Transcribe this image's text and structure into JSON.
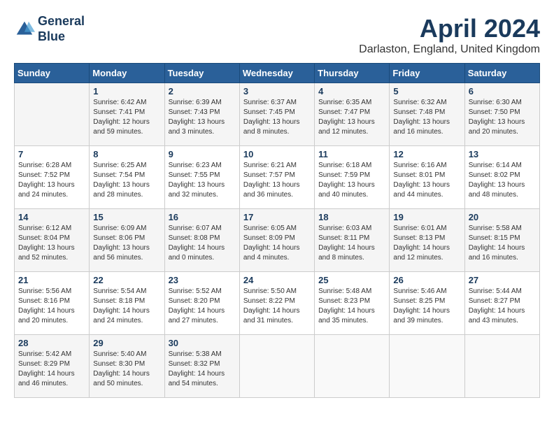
{
  "logo": {
    "line1": "General",
    "line2": "Blue"
  },
  "title": "April 2024",
  "location": "Darlaston, England, United Kingdom",
  "days_of_week": [
    "Sunday",
    "Monday",
    "Tuesday",
    "Wednesday",
    "Thursday",
    "Friday",
    "Saturday"
  ],
  "weeks": [
    [
      {
        "day": "",
        "sunrise": "",
        "sunset": "",
        "daylight": ""
      },
      {
        "day": "1",
        "sunrise": "Sunrise: 6:42 AM",
        "sunset": "Sunset: 7:41 PM",
        "daylight": "Daylight: 12 hours and 59 minutes."
      },
      {
        "day": "2",
        "sunrise": "Sunrise: 6:39 AM",
        "sunset": "Sunset: 7:43 PM",
        "daylight": "Daylight: 13 hours and 3 minutes."
      },
      {
        "day": "3",
        "sunrise": "Sunrise: 6:37 AM",
        "sunset": "Sunset: 7:45 PM",
        "daylight": "Daylight: 13 hours and 8 minutes."
      },
      {
        "day": "4",
        "sunrise": "Sunrise: 6:35 AM",
        "sunset": "Sunset: 7:47 PM",
        "daylight": "Daylight: 13 hours and 12 minutes."
      },
      {
        "day": "5",
        "sunrise": "Sunrise: 6:32 AM",
        "sunset": "Sunset: 7:48 PM",
        "daylight": "Daylight: 13 hours and 16 minutes."
      },
      {
        "day": "6",
        "sunrise": "Sunrise: 6:30 AM",
        "sunset": "Sunset: 7:50 PM",
        "daylight": "Daylight: 13 hours and 20 minutes."
      }
    ],
    [
      {
        "day": "7",
        "sunrise": "Sunrise: 6:28 AM",
        "sunset": "Sunset: 7:52 PM",
        "daylight": "Daylight: 13 hours and 24 minutes."
      },
      {
        "day": "8",
        "sunrise": "Sunrise: 6:25 AM",
        "sunset": "Sunset: 7:54 PM",
        "daylight": "Daylight: 13 hours and 28 minutes."
      },
      {
        "day": "9",
        "sunrise": "Sunrise: 6:23 AM",
        "sunset": "Sunset: 7:55 PM",
        "daylight": "Daylight: 13 hours and 32 minutes."
      },
      {
        "day": "10",
        "sunrise": "Sunrise: 6:21 AM",
        "sunset": "Sunset: 7:57 PM",
        "daylight": "Daylight: 13 hours and 36 minutes."
      },
      {
        "day": "11",
        "sunrise": "Sunrise: 6:18 AM",
        "sunset": "Sunset: 7:59 PM",
        "daylight": "Daylight: 13 hours and 40 minutes."
      },
      {
        "day": "12",
        "sunrise": "Sunrise: 6:16 AM",
        "sunset": "Sunset: 8:01 PM",
        "daylight": "Daylight: 13 hours and 44 minutes."
      },
      {
        "day": "13",
        "sunrise": "Sunrise: 6:14 AM",
        "sunset": "Sunset: 8:02 PM",
        "daylight": "Daylight: 13 hours and 48 minutes."
      }
    ],
    [
      {
        "day": "14",
        "sunrise": "Sunrise: 6:12 AM",
        "sunset": "Sunset: 8:04 PM",
        "daylight": "Daylight: 13 hours and 52 minutes."
      },
      {
        "day": "15",
        "sunrise": "Sunrise: 6:09 AM",
        "sunset": "Sunset: 8:06 PM",
        "daylight": "Daylight: 13 hours and 56 minutes."
      },
      {
        "day": "16",
        "sunrise": "Sunrise: 6:07 AM",
        "sunset": "Sunset: 8:08 PM",
        "daylight": "Daylight: 14 hours and 0 minutes."
      },
      {
        "day": "17",
        "sunrise": "Sunrise: 6:05 AM",
        "sunset": "Sunset: 8:09 PM",
        "daylight": "Daylight: 14 hours and 4 minutes."
      },
      {
        "day": "18",
        "sunrise": "Sunrise: 6:03 AM",
        "sunset": "Sunset: 8:11 PM",
        "daylight": "Daylight: 14 hours and 8 minutes."
      },
      {
        "day": "19",
        "sunrise": "Sunrise: 6:01 AM",
        "sunset": "Sunset: 8:13 PM",
        "daylight": "Daylight: 14 hours and 12 minutes."
      },
      {
        "day": "20",
        "sunrise": "Sunrise: 5:58 AM",
        "sunset": "Sunset: 8:15 PM",
        "daylight": "Daylight: 14 hours and 16 minutes."
      }
    ],
    [
      {
        "day": "21",
        "sunrise": "Sunrise: 5:56 AM",
        "sunset": "Sunset: 8:16 PM",
        "daylight": "Daylight: 14 hours and 20 minutes."
      },
      {
        "day": "22",
        "sunrise": "Sunrise: 5:54 AM",
        "sunset": "Sunset: 8:18 PM",
        "daylight": "Daylight: 14 hours and 24 minutes."
      },
      {
        "day": "23",
        "sunrise": "Sunrise: 5:52 AM",
        "sunset": "Sunset: 8:20 PM",
        "daylight": "Daylight: 14 hours and 27 minutes."
      },
      {
        "day": "24",
        "sunrise": "Sunrise: 5:50 AM",
        "sunset": "Sunset: 8:22 PM",
        "daylight": "Daylight: 14 hours and 31 minutes."
      },
      {
        "day": "25",
        "sunrise": "Sunrise: 5:48 AM",
        "sunset": "Sunset: 8:23 PM",
        "daylight": "Daylight: 14 hours and 35 minutes."
      },
      {
        "day": "26",
        "sunrise": "Sunrise: 5:46 AM",
        "sunset": "Sunset: 8:25 PM",
        "daylight": "Daylight: 14 hours and 39 minutes."
      },
      {
        "day": "27",
        "sunrise": "Sunrise: 5:44 AM",
        "sunset": "Sunset: 8:27 PM",
        "daylight": "Daylight: 14 hours and 43 minutes."
      }
    ],
    [
      {
        "day": "28",
        "sunrise": "Sunrise: 5:42 AM",
        "sunset": "Sunset: 8:29 PM",
        "daylight": "Daylight: 14 hours and 46 minutes."
      },
      {
        "day": "29",
        "sunrise": "Sunrise: 5:40 AM",
        "sunset": "Sunset: 8:30 PM",
        "daylight": "Daylight: 14 hours and 50 minutes."
      },
      {
        "day": "30",
        "sunrise": "Sunrise: 5:38 AM",
        "sunset": "Sunset: 8:32 PM",
        "daylight": "Daylight: 14 hours and 54 minutes."
      },
      {
        "day": "",
        "sunrise": "",
        "sunset": "",
        "daylight": ""
      },
      {
        "day": "",
        "sunrise": "",
        "sunset": "",
        "daylight": ""
      },
      {
        "day": "",
        "sunrise": "",
        "sunset": "",
        "daylight": ""
      },
      {
        "day": "",
        "sunrise": "",
        "sunset": "",
        "daylight": ""
      }
    ]
  ]
}
